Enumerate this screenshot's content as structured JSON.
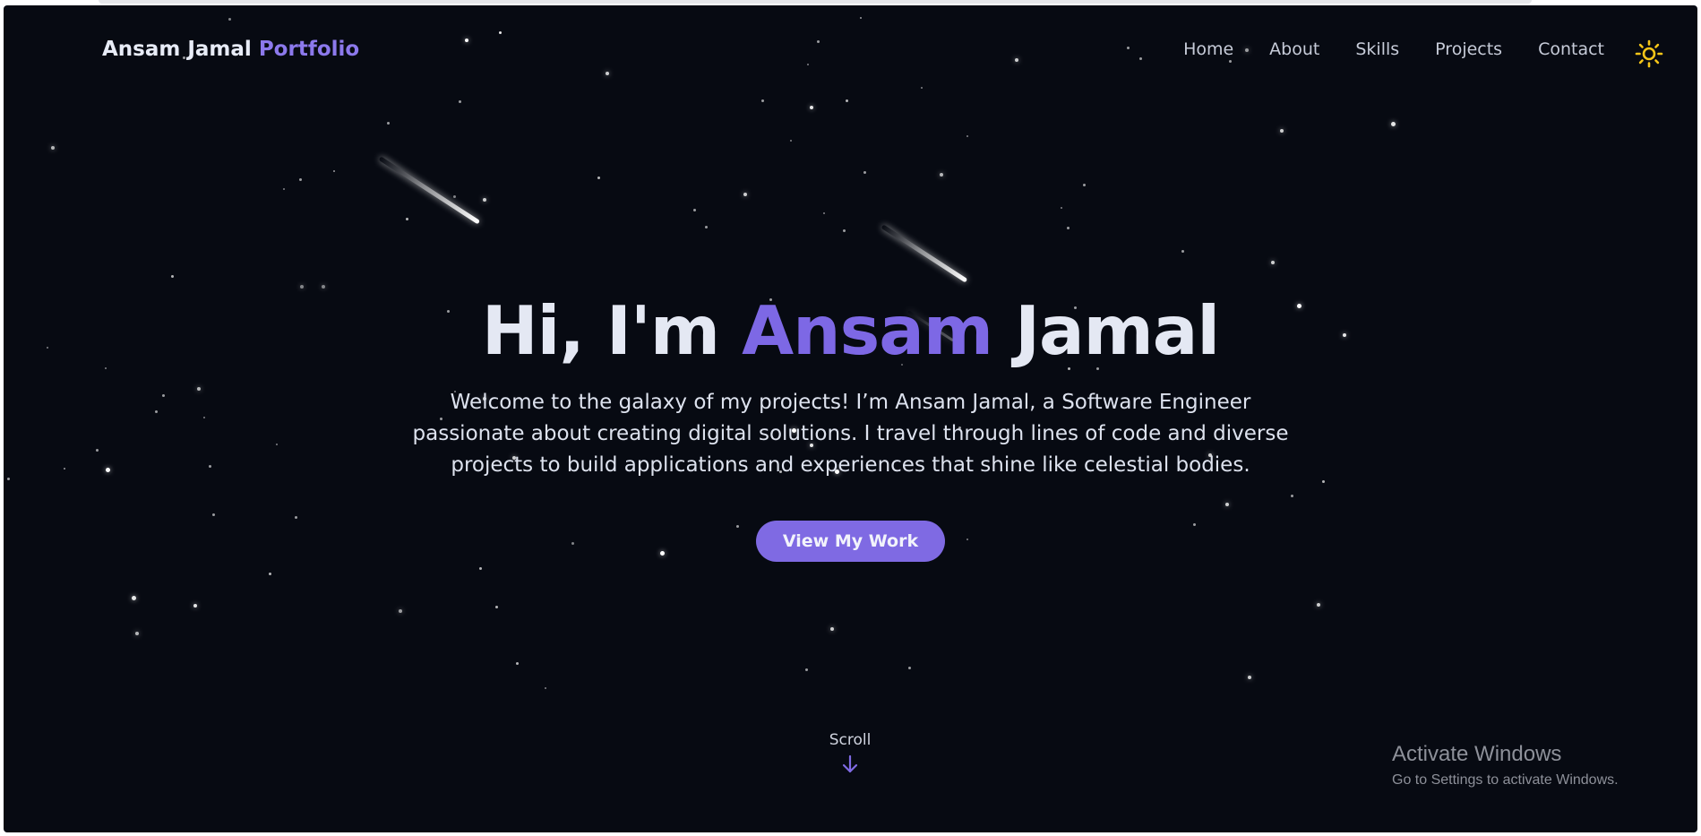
{
  "navbar": {
    "brand_name": "Ansam Jamal",
    "brand_accent": "Portfolio",
    "links": [
      "Home",
      "About",
      "Skills",
      "Projects",
      "Contact"
    ],
    "theme_icon": "sun-icon"
  },
  "hero": {
    "title_prefix": "Hi, I'm",
    "title_accent": "Ansam",
    "title_suffix": "Jamal",
    "subtitle": "Welcome to the galaxy of my projects! I’m Ansam Jamal, a Software Engineer passionate about creating digital solutions. I travel through lines of code and diverse projects to build applications and experiences that shine like celestial bodies.",
    "cta_label": "View My Work"
  },
  "scroll": {
    "label": "Scroll",
    "icon": "arrow-down-icon"
  },
  "watermark": {
    "title": "Activate Windows",
    "subtitle": "Go to Settings to activate Windows."
  },
  "colors": {
    "background": "#070a12",
    "accent": "#7f6ae3",
    "text": "#e4e8f3",
    "sun": "#f5c518"
  }
}
